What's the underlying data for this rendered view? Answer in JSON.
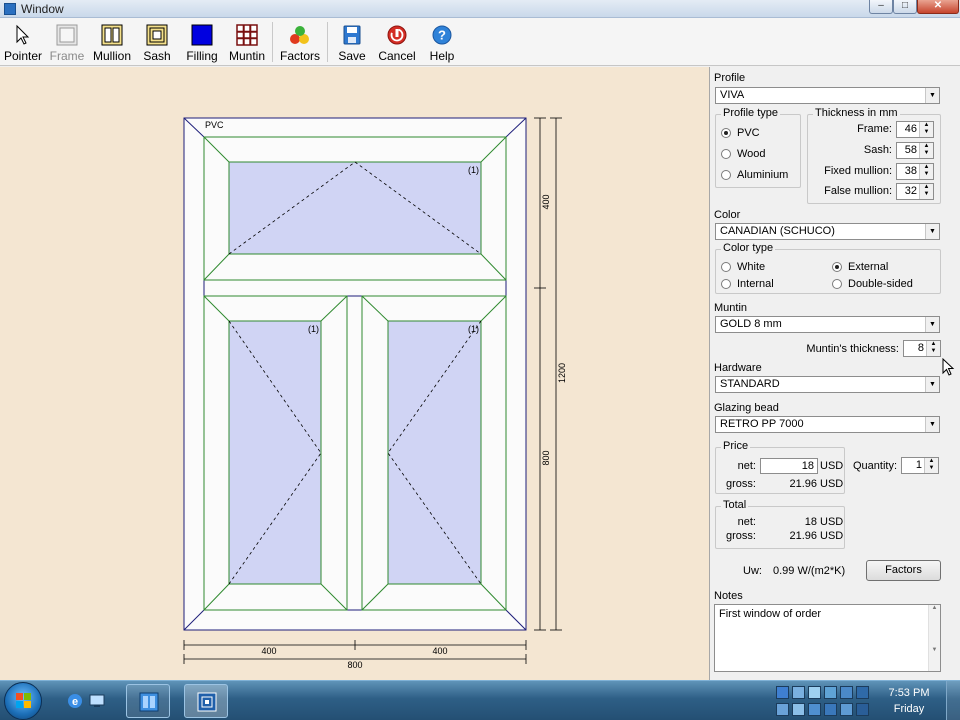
{
  "window": {
    "title": "Window"
  },
  "toolbar": {
    "tools": [
      {
        "label": "Pointer",
        "icon": "pointer-icon"
      },
      {
        "label": "Frame",
        "icon": "frame-icon",
        "disabled": true
      },
      {
        "label": "Mullion",
        "icon": "mullion-icon"
      },
      {
        "label": "Sash",
        "icon": "sash-icon"
      },
      {
        "label": "Filling",
        "icon": "filling-icon"
      },
      {
        "label": "Muntin",
        "icon": "muntin-icon"
      },
      {
        "label": "Factors",
        "icon": "factors-icon"
      },
      {
        "label": "Save",
        "icon": "save-icon"
      },
      {
        "label": "Cancel",
        "icon": "cancel-icon"
      },
      {
        "label": "Help",
        "icon": "help-icon"
      }
    ]
  },
  "drawing": {
    "material_label": "PVC",
    "sash_marks": [
      "(1)",
      "(1)",
      "(1)"
    ],
    "dim_right_top": "400",
    "dim_right_total": "1200",
    "dim_right_bottom": "800",
    "dim_bottom_left": "400",
    "dim_bottom_right": "400",
    "dim_bottom_total": "800",
    "colors": {
      "frame": "#1e1e7a",
      "sash": "#2f8a2f",
      "glass": "#d0d4f4",
      "background": "#f4e6d2"
    }
  },
  "panel": {
    "profile": {
      "label": "Profile",
      "value": "VIVA"
    },
    "profile_type": {
      "title": "Profile type",
      "options": [
        "PVC",
        "Wood",
        "Aluminium"
      ],
      "selected": "PVC"
    },
    "thickness": {
      "title": "Thickness in mm",
      "rows": [
        {
          "label": "Frame:",
          "value": "46"
        },
        {
          "label": "Sash:",
          "value": "58"
        },
        {
          "label": "Fixed mullion:",
          "value": "38"
        },
        {
          "label": "False mullion:",
          "value": "32"
        }
      ]
    },
    "color": {
      "label": "Color",
      "value": "CANADIAN (SCHUCO)"
    },
    "color_type": {
      "title": "Color type",
      "options": [
        "White",
        "External",
        "Internal",
        "Double-sided"
      ],
      "selected": "External"
    },
    "muntin": {
      "label": "Muntin",
      "value": "GOLD 8 mm",
      "thickness_label": "Muntin's thickness:",
      "thickness": "8"
    },
    "hardware": {
      "label": "Hardware",
      "value": "STANDARD"
    },
    "glazing_bead": {
      "label": "Glazing bead",
      "value": "RETRO PP 7000"
    },
    "price": {
      "title": "Price",
      "net_label": "net:",
      "net": "18",
      "net_unit": "USD",
      "gross_label": "gross:",
      "gross": "21.96",
      "gross_unit": "USD",
      "quantity_label": "Quantity:",
      "quantity": "1"
    },
    "total": {
      "title": "Total",
      "net_label": "net:",
      "net": "18",
      "net_unit": "USD",
      "gross_label": "gross:",
      "gross": "21.96",
      "gross_unit": "USD"
    },
    "uw": {
      "label": "Uw:",
      "value": "0.99 W/(m2*K)"
    },
    "factors_button": "Factors",
    "notes": {
      "label": "Notes",
      "value": "First window of order"
    }
  },
  "taskbar": {
    "clock_time": "7:53 PM",
    "clock_day": "Friday"
  }
}
